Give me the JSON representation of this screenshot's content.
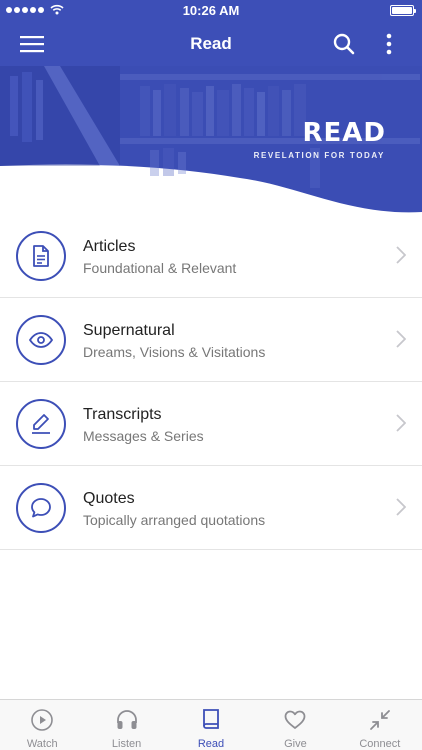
{
  "status_bar": {
    "time": "10:26 AM"
  },
  "nav": {
    "title": "Read",
    "menu_icon": "hamburger-menu-icon",
    "search_icon": "search-icon",
    "more_icon": "more-vertical-icon"
  },
  "banner": {
    "title": "READ",
    "subtitle": "REVELATION FOR TODAY"
  },
  "list": [
    {
      "title": "Articles",
      "subtitle": "Foundational & Relevant",
      "icon": "document-icon"
    },
    {
      "title": "Supernatural",
      "subtitle": "Dreams, Visions & Visitations",
      "icon": "eye-icon"
    },
    {
      "title": "Transcripts",
      "subtitle": "Messages & Series",
      "icon": "pencil-icon"
    },
    {
      "title": "Quotes",
      "subtitle": "Topically arranged quotations",
      "icon": "chat-bubble-icon"
    }
  ],
  "tabs": [
    {
      "label": "Watch",
      "icon": "play-circle-icon"
    },
    {
      "label": "Listen",
      "icon": "headphones-icon"
    },
    {
      "label": "Read",
      "icon": "book-icon",
      "active": true
    },
    {
      "label": "Give",
      "icon": "heart-icon"
    },
    {
      "label": "Connect",
      "icon": "compress-arrows-icon"
    }
  ],
  "colors": {
    "primary": "#3d4fb7",
    "inactive": "#8e8e93",
    "divider": "#e4e4e4"
  }
}
